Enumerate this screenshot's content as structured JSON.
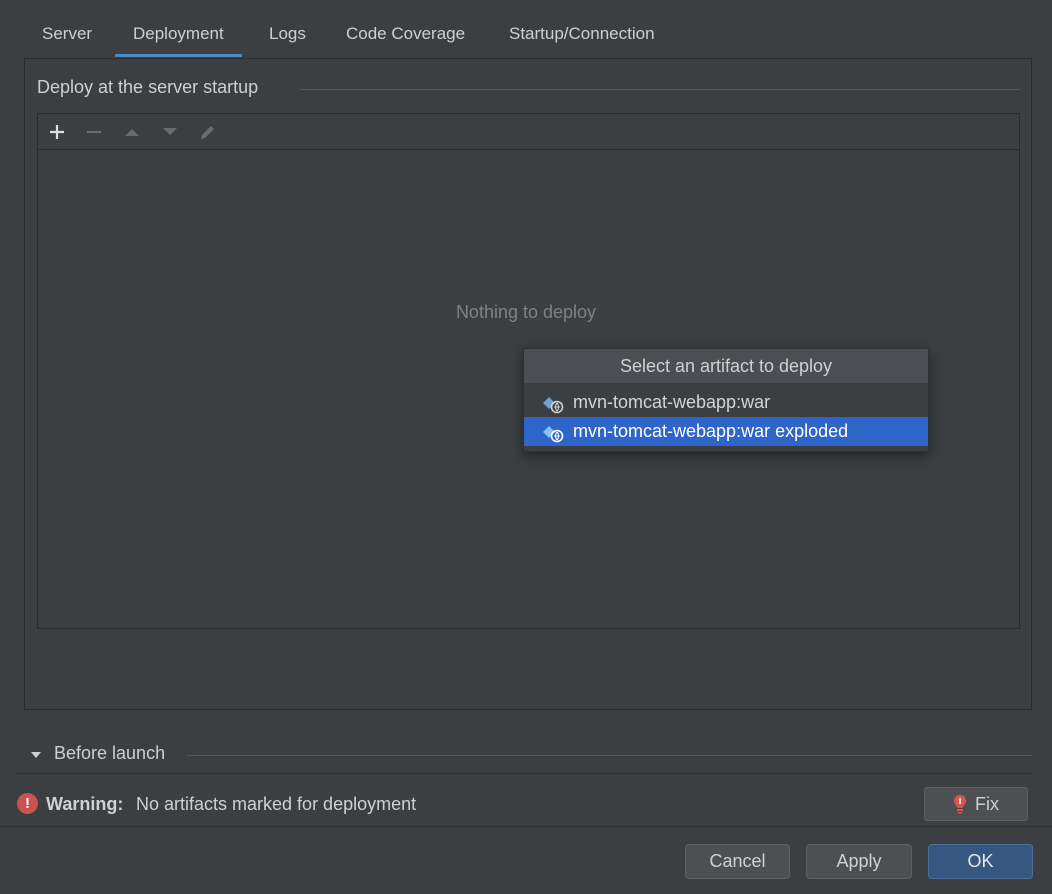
{
  "tabs": [
    {
      "label": "Server"
    },
    {
      "label": "Deployment"
    },
    {
      "label": "Logs"
    },
    {
      "label": "Code Coverage"
    },
    {
      "label": "Startup/Connection"
    }
  ],
  "active_tab": "Deployment",
  "deploy_section": {
    "title": "Deploy at the server startup",
    "empty_text": "Nothing to deploy",
    "toolbar": [
      "add-icon",
      "remove-icon",
      "move-up-icon",
      "move-down-icon",
      "edit-icon"
    ]
  },
  "popup": {
    "title": "Select an artifact to deploy",
    "items": [
      {
        "label": "mvn-tomcat-webapp:war",
        "selected": false
      },
      {
        "label": "mvn-tomcat-webapp:war exploded",
        "selected": true
      }
    ]
  },
  "before_launch": {
    "label": "Before launch"
  },
  "warning": {
    "strong": "Warning:",
    "text": "No artifacts marked for deployment",
    "icon_text": "!"
  },
  "buttons": {
    "fix": "Fix",
    "cancel": "Cancel",
    "apply": "Apply",
    "ok": "OK"
  },
  "colors": {
    "background": "#3c3f41",
    "accent": "#4a88c7",
    "selection": "#2f65ca",
    "warning": "#c75450"
  }
}
